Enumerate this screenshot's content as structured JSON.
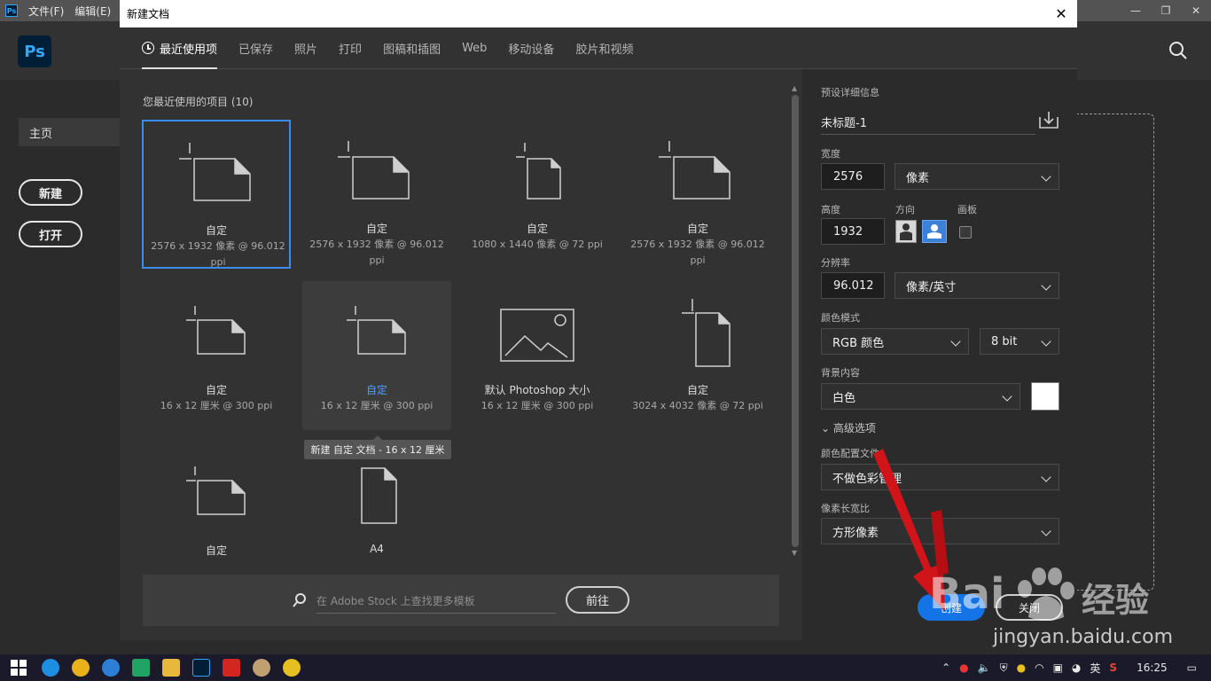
{
  "app": {
    "menu": [
      "文件(F)",
      "编辑(E)"
    ],
    "logo": "Ps",
    "home_tab": "主页",
    "new_button": "新建",
    "open_button": "打开"
  },
  "dialog": {
    "title": "新建文档",
    "tabs": [
      "最近使用项",
      "已保存",
      "照片",
      "打印",
      "图稿和插图",
      "Web",
      "移动设备",
      "胶片和视频"
    ],
    "recent_label": "您最近使用的项目 (10)",
    "presets": [
      {
        "name": "自定",
        "detail": "2576 x 1932 像素 @ 96.012 ppi"
      },
      {
        "name": "自定",
        "detail": "2576 x 1932 像素 @ 96.012 ppi"
      },
      {
        "name": "自定",
        "detail": "1080 x 1440 像素 @ 72 ppi"
      },
      {
        "name": "自定",
        "detail": "2576 x 1932 像素 @ 96.012 ppi"
      },
      {
        "name": "自定",
        "detail": "16 x 12 厘米 @ 300 ppi"
      },
      {
        "name": "自定",
        "detail": "16 x 12 厘米 @ 300 ppi"
      },
      {
        "name": "默认 Photoshop 大小",
        "detail": "16 x 12 厘米 @ 300 ppi"
      },
      {
        "name": "自定",
        "detail": "3024 x 4032 像素 @ 72 ppi"
      },
      {
        "name": "自定",
        "detail": ""
      },
      {
        "name": "A4",
        "detail": ""
      }
    ],
    "tooltip": "新建 自定 文档 - 16 x 12 厘米",
    "stock_placeholder": "在 Adobe Stock 上查找更多模板",
    "goto_button": "前往"
  },
  "details": {
    "section_title": "预设详细信息",
    "doc_name": "未标题-1",
    "width_label": "宽度",
    "width_value": "2576",
    "width_unit": "像素",
    "height_label": "高度",
    "height_value": "1932",
    "orientation_label": "方向",
    "artboard_label": "画板",
    "resolution_label": "分辨率",
    "resolution_value": "96.012",
    "resolution_unit": "像素/英寸",
    "color_mode_label": "颜色模式",
    "color_mode": "RGB 颜色",
    "bit_depth": "8 bit",
    "background_label": "背景内容",
    "background": "白色",
    "background_color": "#ffffff",
    "advanced_label": "高级选项",
    "color_profile_label": "颜色配置文件",
    "color_profile": "不做色彩管理",
    "pixel_aspect_label": "像素长宽比",
    "pixel_aspect": "方形像素",
    "create_button": "创建",
    "close_button": "关闭"
  },
  "watermark": {
    "logo": "Bai",
    "site_cn": "经验",
    "url": "jingyan.baidu.com"
  },
  "taskbar": {
    "ime": "英",
    "clock": "16:25"
  },
  "colors": {
    "accent": "#1473e6",
    "selection": "#3b8cf0",
    "arrow": "#d0141a"
  }
}
